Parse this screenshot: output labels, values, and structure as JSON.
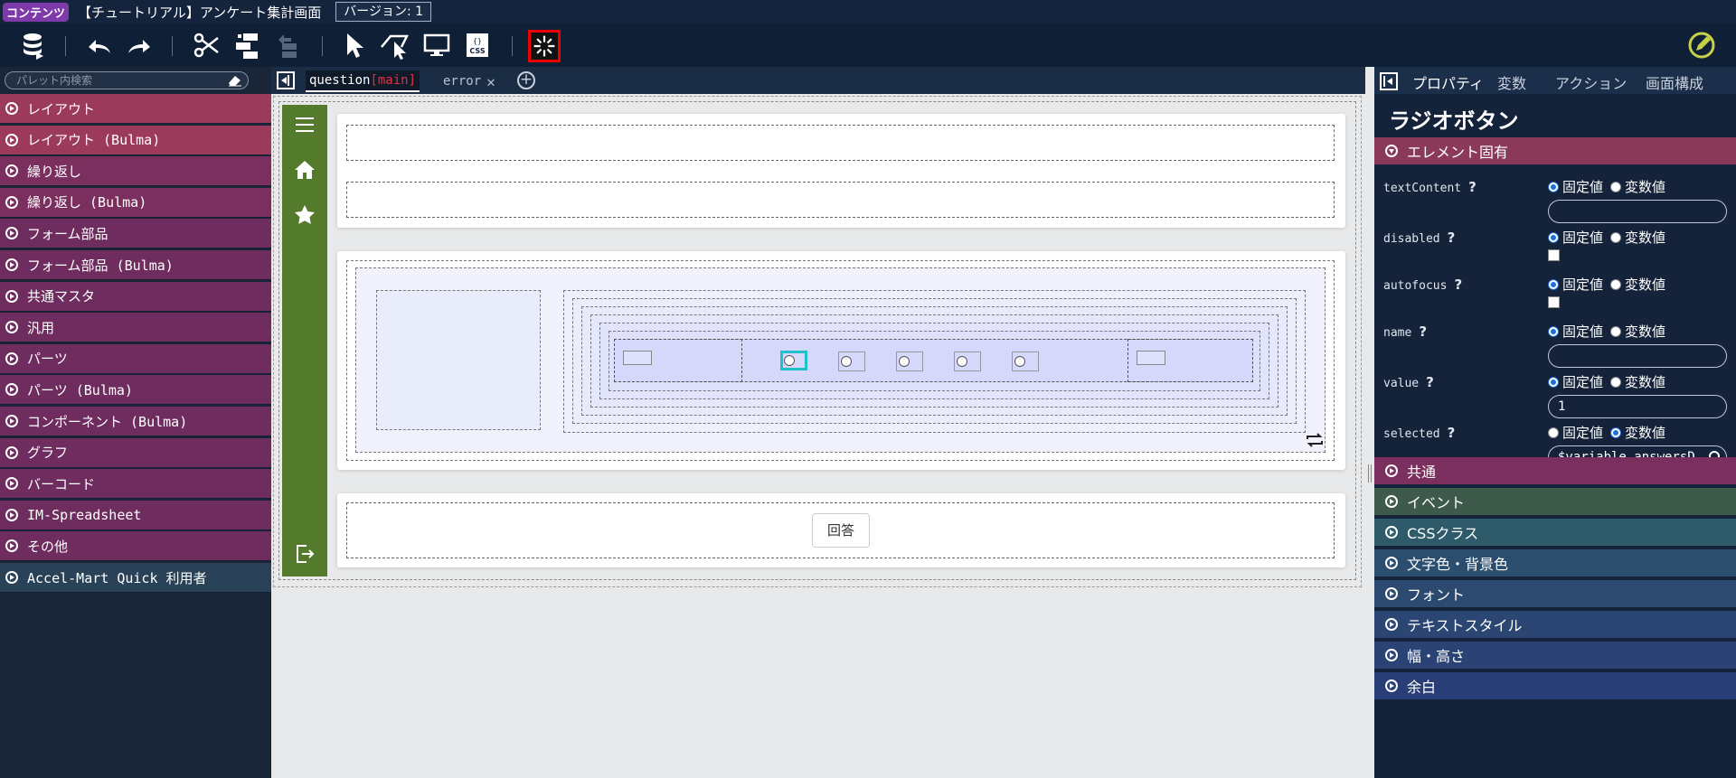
{
  "top": {
    "badge": "コンテンツ",
    "title": "【チュートリアル】アンケート集計画面",
    "version": "バージョン: 1"
  },
  "palette": {
    "search_placeholder": "パレット内検索",
    "items": [
      {
        "label": "レイアウト",
        "color": "#9b3a5a"
      },
      {
        "label": "レイアウト (Bulma)",
        "color": "#9b3a5a"
      },
      {
        "label": "繰り返し",
        "color": "#7a2f5e"
      },
      {
        "label": "繰り返し (Bulma)",
        "color": "#7a2f5e"
      },
      {
        "label": "フォーム部品",
        "color": "#6e2d5e"
      },
      {
        "label": "フォーム部品 (Bulma)",
        "color": "#6e2d5e"
      },
      {
        "label": "共通マスタ",
        "color": "#6e2d5e"
      },
      {
        "label": "汎用",
        "color": "#6e2d5e"
      },
      {
        "label": "パーツ",
        "color": "#6e2d5e"
      },
      {
        "label": "パーツ (Bulma)",
        "color": "#6e2d5e"
      },
      {
        "label": "コンポーネント (Bulma)",
        "color": "#6e2d5e"
      },
      {
        "label": "グラフ",
        "color": "#6e2d5e"
      },
      {
        "label": "バーコード",
        "color": "#6e2d5e"
      },
      {
        "label": "IM-Spreadsheet",
        "color": "#6e2d5e"
      },
      {
        "label": "その他",
        "color": "#6e2d5e"
      },
      {
        "label": "Accel-Mart Quick 利用者",
        "color": "#2a4258"
      }
    ]
  },
  "tabs": {
    "question": "question",
    "question_suffix": "[main]",
    "error": "error"
  },
  "canvas": {
    "answer_button": "回答"
  },
  "rpanel": {
    "tabs": [
      "プロパティ",
      "変数",
      "アクション",
      "画面構成"
    ],
    "element_title": "ラジオボタン",
    "section_own": "エレメント固有",
    "fixed": "固定値",
    "variable": "変数値",
    "props": [
      {
        "name": "textContent",
        "mode": "fixed",
        "kind": "input",
        "value": ""
      },
      {
        "name": "disabled",
        "mode": "fixed",
        "kind": "check",
        "value": ""
      },
      {
        "name": "autofocus",
        "mode": "fixed",
        "kind": "check",
        "value": ""
      },
      {
        "name": "name",
        "mode": "fixed",
        "kind": "input",
        "value": ""
      },
      {
        "name": "value",
        "mode": "fixed",
        "kind": "input",
        "value": "1"
      },
      {
        "name": "selected",
        "mode": "variable",
        "kind": "input",
        "value": "$variable.answersD"
      }
    ],
    "sections": [
      {
        "label": "共通",
        "color": "#7a2f5e"
      },
      {
        "label": "イベント",
        "color": "#3d5a4a"
      },
      {
        "label": "CSSクラス",
        "color": "#2e5a6a"
      },
      {
        "label": "文字色・背景色",
        "color": "#2c4e6e"
      },
      {
        "label": "フォント",
        "color": "#2c4a70"
      },
      {
        "label": "テキストスタイル",
        "color": "#2b4672"
      },
      {
        "label": "幅・高さ",
        "color": "#2a4274"
      },
      {
        "label": "余白",
        "color": "#293e76"
      }
    ]
  }
}
